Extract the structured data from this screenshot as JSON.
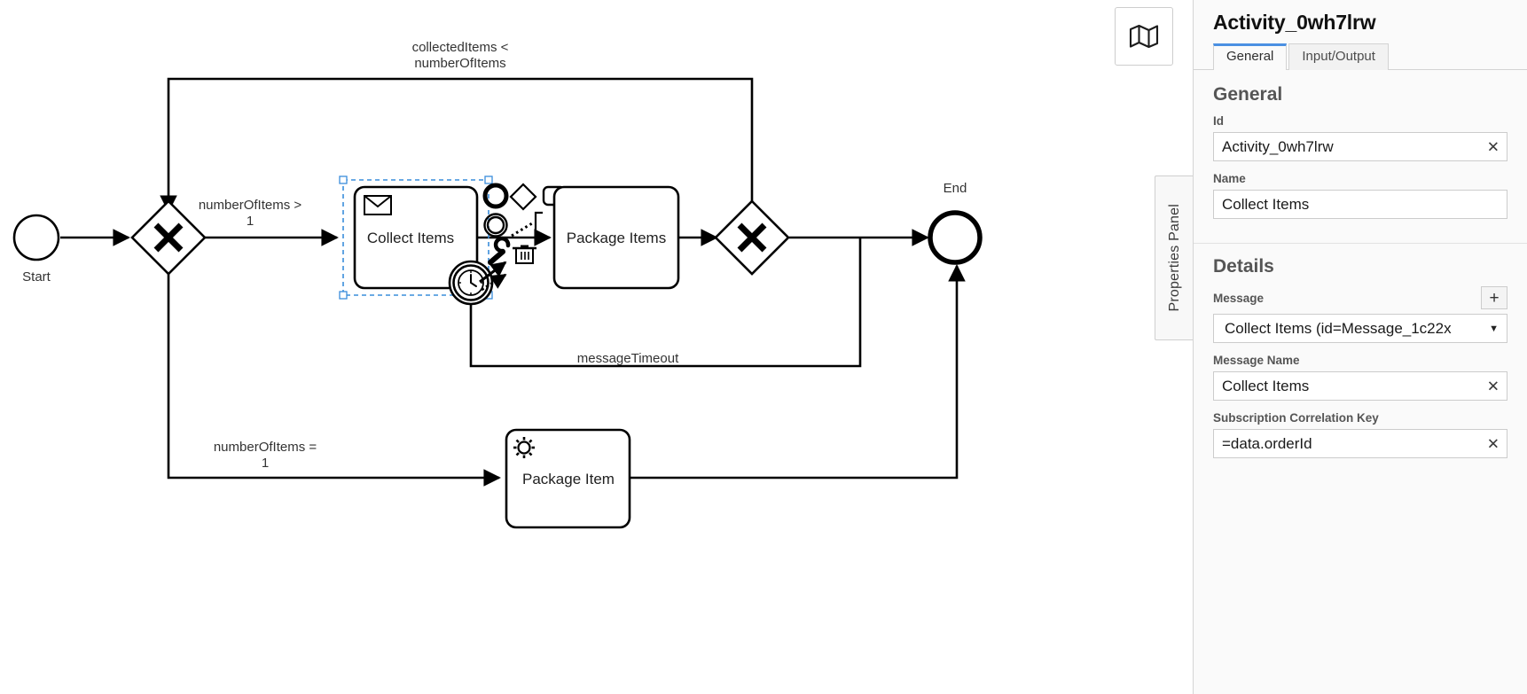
{
  "canvas": {
    "minimap_button": "map-icon",
    "properties_tab_label": "Properties Panel",
    "elements": {
      "start_event": "Start",
      "gateway_split": "X",
      "collect_items": "Collect Items",
      "package_items": "Package Items",
      "gateway_join": "X",
      "end_event": "End",
      "package_item": "Package Item"
    },
    "flow_labels": {
      "loop_back_line1": "collectedItems <",
      "loop_back_line2": "numberOfItems",
      "branch_many_line1": "numberOfItems >",
      "branch_many_line2": "1",
      "branch_one_line1": "numberOfItems =",
      "branch_one_line2": "1",
      "timeout": "messageTimeout"
    },
    "context_pad": [
      {
        "name": "append-end-event-icon",
        "label": "Append EndEvent"
      },
      {
        "name": "append-gateway-icon",
        "label": "Append Gateway"
      },
      {
        "name": "append-task-icon",
        "label": "Append Task"
      },
      {
        "name": "change-type-gear-icon",
        "label": "Change type"
      },
      {
        "name": "append-intermediate-event-icon",
        "label": "Append Intermediate/Boundary Event"
      },
      {
        "name": "append-text-annotation-icon",
        "label": "Append TextAnnotation"
      },
      {
        "name": "connect-icon",
        "label": "Connect"
      },
      {
        "name": "wrench-icon",
        "label": "Change element"
      },
      {
        "name": "delete-trash-icon",
        "label": "Remove"
      }
    ]
  },
  "panel": {
    "title": "Activity_0wh7lrw",
    "tabs": [
      {
        "label": "General",
        "active": true
      },
      {
        "label": "Input/Output",
        "active": false
      }
    ],
    "general": {
      "heading": "General",
      "id_label": "Id",
      "id_value": "Activity_0wh7lrw",
      "name_label": "Name",
      "name_value": "Collect Items"
    },
    "details": {
      "heading": "Details",
      "message_label": "Message",
      "message_add_button": "+",
      "message_value": "Collect Items (id=Message_1c22x",
      "message_caret": "▼",
      "message_name_label": "Message Name",
      "message_name_value": "Collect Items",
      "correlation_label": "Subscription Correlation Key",
      "correlation_value": "=data.orderId"
    },
    "clear_icon": "✕",
    "accent_color": "#4a90e2"
  }
}
